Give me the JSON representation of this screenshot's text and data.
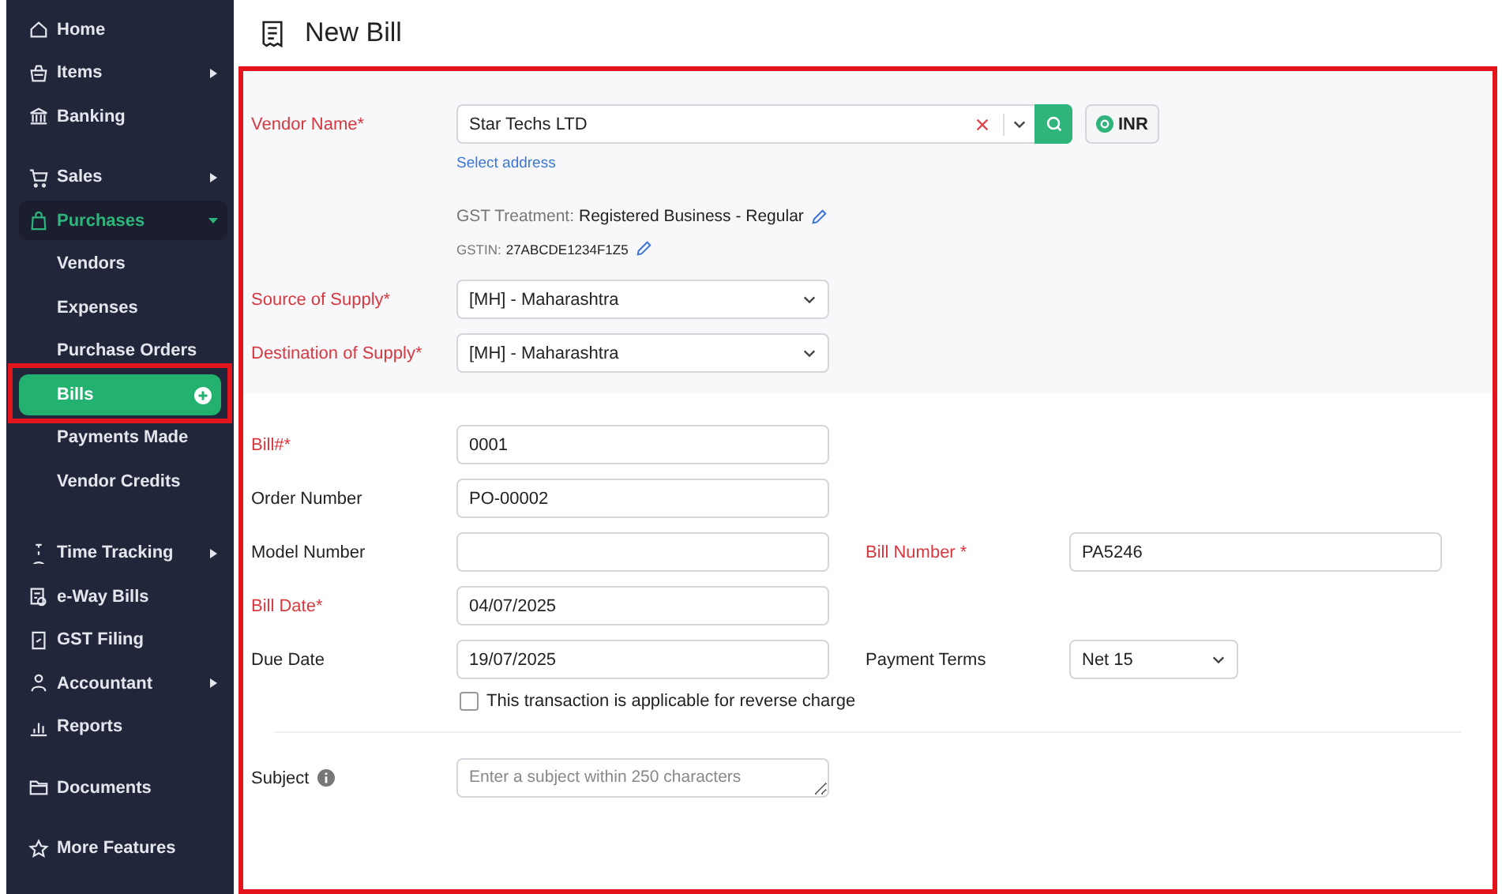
{
  "sidebar": {
    "sections": [
      {
        "items": [
          {
            "label": "Home",
            "has_submenu": false,
            "expanded": false
          },
          {
            "label": "Items",
            "has_submenu": true,
            "expanded": false
          },
          {
            "label": "Banking",
            "has_submenu": false,
            "expanded": false
          }
        ]
      },
      {
        "items": [
          {
            "label": "Sales",
            "has_submenu": true,
            "expanded": false
          },
          {
            "label": "Purchases",
            "has_submenu": true,
            "expanded": true,
            "children": [
              {
                "label": "Vendors",
                "selected": false,
                "highlighted": false
              },
              {
                "label": "Expenses",
                "selected": false,
                "highlighted": false
              },
              {
                "label": "Purchase Orders",
                "selected": false,
                "highlighted": false
              },
              {
                "label": "Bills",
                "selected": true,
                "highlighted": true
              },
              {
                "label": "Payments Made",
                "selected": false,
                "highlighted": false
              },
              {
                "label": "Vendor Credits",
                "selected": false,
                "highlighted": false
              }
            ]
          }
        ]
      },
      {
        "items": [
          {
            "label": "Time Tracking",
            "has_submenu": true,
            "expanded": false
          },
          {
            "label": "e-Way Bills",
            "has_submenu": false,
            "expanded": false
          },
          {
            "label": "GST Filing",
            "has_submenu": false,
            "expanded": false
          },
          {
            "label": "Accountant",
            "has_submenu": true,
            "expanded": false
          },
          {
            "label": "Reports",
            "has_submenu": false,
            "expanded": false
          }
        ]
      },
      {
        "items": [
          {
            "label": "Documents",
            "has_submenu": false,
            "expanded": false
          }
        ]
      },
      {
        "items": [
          {
            "label": "More Features",
            "has_submenu": false,
            "expanded": false
          }
        ]
      }
    ]
  },
  "page": {
    "title": "New Bill"
  },
  "form": {
    "highlighted": true,
    "vendor": {
      "label": "Vendor Name*",
      "required": true,
      "value": "Star Techs LTD",
      "address_link": "Select address",
      "currency": "INR"
    },
    "gst_treatment": {
      "label": "GST Treatment:",
      "value": "Registered Business - Regular"
    },
    "gstin": {
      "label": "GSTIN:",
      "value": "27ABCDE1234F1Z5"
    },
    "supply": [
      {
        "label": "Source of Supply*",
        "required": true,
        "value": "[MH] - Maharashtra"
      },
      {
        "label": "Destination of Supply*",
        "required": true,
        "value": "[MH] - Maharashtra"
      }
    ],
    "rows": [
      [
        {
          "kind": "text",
          "label": "Bill#*",
          "required": true,
          "value": "0001"
        }
      ],
      [
        {
          "kind": "text",
          "label": "Order Number",
          "required": false,
          "value": "PO-00002"
        }
      ],
      [
        {
          "kind": "text",
          "label": "Model Number",
          "required": false
        },
        {
          "kind": "text",
          "label": "Bill Number *",
          "required": true,
          "value": "PA5246"
        }
      ],
      [
        {
          "kind": "text",
          "label": "Bill Date*",
          "required": true,
          "value": "04/07/2025"
        }
      ],
      [
        {
          "kind": "text",
          "label": "Due Date",
          "required": false,
          "value": "19/07/2025"
        },
        {
          "kind": "select",
          "label": "Payment Terms",
          "required": false,
          "value": "Net 15"
        }
      ]
    ],
    "reverse_charge": {
      "label": "This transaction is applicable for reverse charge",
      "checked": false
    },
    "subject": {
      "label": "Subject",
      "placeholder": "Enter a subject within 250 characters"
    }
  }
}
